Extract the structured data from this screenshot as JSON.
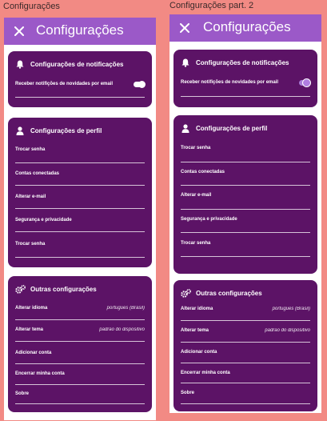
{
  "frames": [
    {
      "caption": "Configurações",
      "title": "Configurações",
      "notifications": {
        "title": "Configurações de notificações",
        "email_label": "Receber notifições de novidades por email",
        "toggle_on": false
      },
      "profile": {
        "title": "Configurações de perfil",
        "items": [
          "Trocar senha",
          "Contas conectadas",
          "Alterar e-mail",
          "Segurança e privacidade",
          "Trocar senha"
        ]
      },
      "other": {
        "title": "Outras configurações",
        "items": [
          {
            "label": "Alterar idioma",
            "value": "portugues (Brasil)"
          },
          {
            "label": "Alterar tema",
            "value": "padrão do dispositivo"
          },
          {
            "label": "Adicionar conta",
            "value": ""
          },
          {
            "label": "Encerrar minha conta",
            "value": ""
          },
          {
            "label": "Sobre",
            "value": ""
          }
        ]
      }
    },
    {
      "caption": "Configurações part. 2",
      "title": "Configurações",
      "notifications": {
        "title": "Configurações de notificações",
        "email_label": "Receber notifições de novidades por email",
        "toggle_on": true
      },
      "profile": {
        "title": "Configurações de perfil",
        "items": [
          "Trocar senha",
          "Contas conectadas",
          "Alterar e-mail",
          "Segurança e privacidade",
          "Trocar senha"
        ]
      },
      "other": {
        "title": "Outras configurações",
        "items": [
          {
            "label": "Alterar idioma",
            "value": "portugues (Brasil)"
          },
          {
            "label": "Alterar tema",
            "value": "padrão do dispositivo"
          },
          {
            "label": "Adicionar conta",
            "value": ""
          },
          {
            "label": "Encerrar minha conta",
            "value": ""
          },
          {
            "label": "Sobre",
            "value": ""
          }
        ]
      }
    }
  ],
  "colors": {
    "background": "#f28a84",
    "topbar": "#9b59c8",
    "card": "#5c1366",
    "toggle_on": "#b07de0"
  },
  "icons": {
    "close": "close-icon",
    "notifications": "bell-icon",
    "profile": "person-icon",
    "other": "gears-icon"
  }
}
